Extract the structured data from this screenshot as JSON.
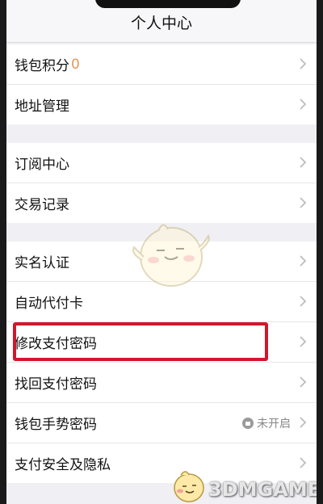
{
  "header": {
    "title": "个人中心"
  },
  "groups": [
    {
      "rows": [
        {
          "label": "钱包积分",
          "value": "0"
        },
        {
          "label": "地址管理"
        }
      ]
    },
    {
      "rows": [
        {
          "label": "订阅中心"
        },
        {
          "label": "交易记录"
        }
      ]
    },
    {
      "rows": [
        {
          "label": "实名认证"
        },
        {
          "label": "自动代付卡"
        },
        {
          "label": "修改支付密码"
        },
        {
          "label": "找回支付密码"
        },
        {
          "label": "钱包手势密码",
          "status": "未开启"
        },
        {
          "label": "支付安全及隐私"
        }
      ]
    }
  ],
  "watermark": {
    "text": "3DMGAME"
  },
  "colors": {
    "highlight": "#d0172c",
    "value_accent": "#e09a5a"
  },
  "icons": [
    "chevron-right-icon",
    "lock-icon"
  ]
}
